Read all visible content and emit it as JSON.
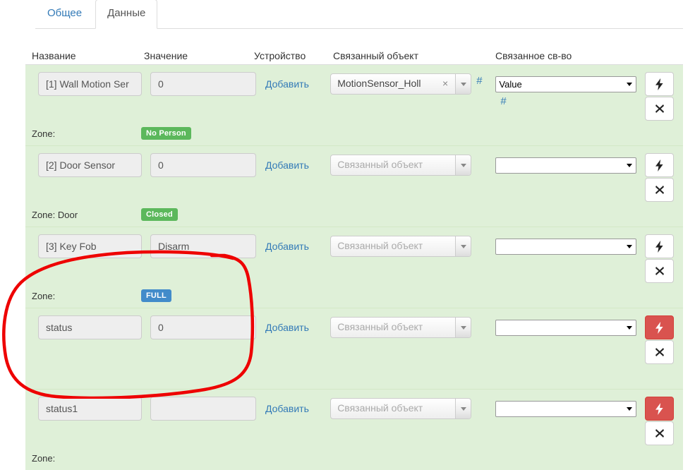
{
  "tabs": [
    {
      "label": "Общее",
      "active": false
    },
    {
      "label": "Данные",
      "active": true
    }
  ],
  "columns": {
    "name": "Название",
    "value": "Значение",
    "device": "Устройство",
    "linked_object": "Связанный объект",
    "linked_property": "Связанное св-во"
  },
  "labels": {
    "add": "Добавить",
    "zone": "Zone:",
    "hash": "#",
    "object_placeholder": "Связанный объект",
    "clear": "×"
  },
  "colors": {
    "row_background": "#dff0d8",
    "badge_green": "#5cb85c",
    "badge_blue": "#428bca",
    "link_blue": "#337ab7",
    "danger_red": "#d9534f",
    "annotation_red": "#ee0000"
  },
  "rows": [
    {
      "name": "[1] Wall Motion Ser",
      "value": "0",
      "add_label": "Добавить",
      "object_value": "MotionSensor_Holl",
      "object_is_placeholder": false,
      "object_clearable": true,
      "object_hash": "#",
      "property_value": "Value",
      "property_hash": "#",
      "zone_label": "Zone:",
      "zone_badge": "No Person",
      "zone_badge_color": "green",
      "lightning_danger": false
    },
    {
      "name": "[2] Door Sensor",
      "value": "0",
      "add_label": "Добавить",
      "object_value": "Связанный объект",
      "object_is_placeholder": true,
      "object_clearable": false,
      "object_hash": "",
      "property_value": "",
      "property_hash": "",
      "zone_label": "Zone: Door",
      "zone_badge": "Closed",
      "zone_badge_color": "green",
      "lightning_danger": false
    },
    {
      "name": "[3] Key Fob",
      "value": "Disarm",
      "add_label": "Добавить",
      "object_value": "Связанный объект",
      "object_is_placeholder": true,
      "object_clearable": false,
      "object_hash": "",
      "property_value": "",
      "property_hash": "",
      "zone_label": "Zone:",
      "zone_badge": "FULL",
      "zone_badge_color": "blue",
      "lightning_danger": false
    },
    {
      "name": "status",
      "value": "0",
      "add_label": "Добавить",
      "object_value": "Связанный объект",
      "object_is_placeholder": true,
      "object_clearable": false,
      "object_hash": "",
      "property_value": "",
      "property_hash": "",
      "zone_label": "",
      "zone_badge": "",
      "zone_badge_color": "",
      "lightning_danger": true
    },
    {
      "name": "status1",
      "value": "",
      "add_label": "Добавить",
      "object_value": "Связанный объект",
      "object_is_placeholder": true,
      "object_clearable": false,
      "object_hash": "",
      "property_value": "",
      "property_hash": "",
      "zone_label": "Zone:",
      "zone_badge": "",
      "zone_badge_color": "",
      "lightning_danger": true
    }
  ]
}
